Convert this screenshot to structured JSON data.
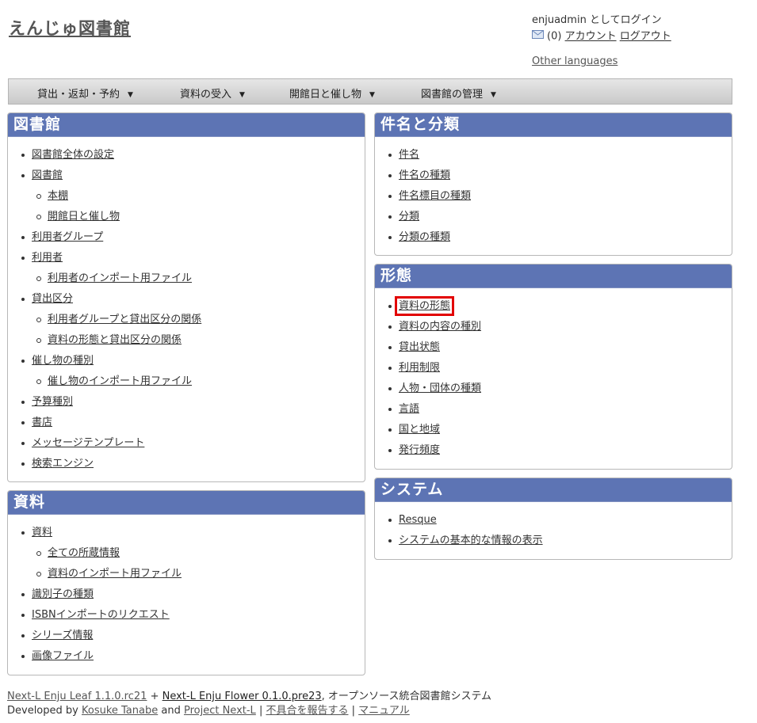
{
  "header": {
    "site_title": "えんじゅ図書館",
    "user_label": "enjuadmin としてログイン",
    "message_count": "(0)",
    "account_link": "アカウント",
    "logout_link": "ログアウト",
    "other_languages": "Other languages"
  },
  "nav": [
    {
      "label": "貸出・返却・予約"
    },
    {
      "label": "資料の受入"
    },
    {
      "label": "開館日と催し物"
    },
    {
      "label": "図書館の管理"
    }
  ],
  "panels": {
    "library": {
      "title": "図書館",
      "items": [
        {
          "label": "図書館全体の設定",
          "level": 1
        },
        {
          "label": "図書館",
          "level": 1
        },
        {
          "label": "本棚",
          "level": 2
        },
        {
          "label": "開館日と催し物",
          "level": 2
        },
        {
          "label": "利用者グループ",
          "level": 1
        },
        {
          "label": "利用者",
          "level": 1
        },
        {
          "label": "利用者のインポート用ファイル",
          "level": 2
        },
        {
          "label": "貸出区分",
          "level": 1
        },
        {
          "label": "利用者グループと貸出区分の関係",
          "level": 2
        },
        {
          "label": "資料の形態と貸出区分の関係",
          "level": 2
        },
        {
          "label": "催し物の種別",
          "level": 1
        },
        {
          "label": "催し物のインポート用ファイル",
          "level": 2
        },
        {
          "label": "予算種別",
          "level": 1
        },
        {
          "label": "書店",
          "level": 1
        },
        {
          "label": "メッセージテンプレート",
          "level": 1
        },
        {
          "label": "検索エンジン",
          "level": 1
        }
      ]
    },
    "resources": {
      "title": "資料",
      "items": [
        {
          "label": "資料",
          "level": 1
        },
        {
          "label": "全ての所蔵情報",
          "level": 2
        },
        {
          "label": "資料のインポート用ファイル",
          "level": 2
        },
        {
          "label": "識別子の種類",
          "level": 1
        },
        {
          "label": "ISBNインポートのリクエスト",
          "level": 1
        },
        {
          "label": "シリーズ情報",
          "level": 1
        },
        {
          "label": "画像ファイル",
          "level": 1
        }
      ]
    },
    "subjects": {
      "title": "件名と分類",
      "items": [
        {
          "label": "件名",
          "level": 1
        },
        {
          "label": "件名の種類",
          "level": 1
        },
        {
          "label": "件名標目の種類",
          "level": 1
        },
        {
          "label": "分類",
          "level": 1
        },
        {
          "label": "分類の種類",
          "level": 1
        }
      ]
    },
    "forms": {
      "title": "形態",
      "items": [
        {
          "label": "資料の形態",
          "level": 1,
          "highlighted": true
        },
        {
          "label": "資料の内容の種別",
          "level": 1
        },
        {
          "label": "貸出状態",
          "level": 1
        },
        {
          "label": "利用制限",
          "level": 1
        },
        {
          "label": "人物・団体の種類",
          "level": 1
        },
        {
          "label": "言語",
          "level": 1
        },
        {
          "label": "国と地域",
          "level": 1
        },
        {
          "label": "発行頻度",
          "level": 1
        }
      ]
    },
    "system": {
      "title": "システム",
      "items": [
        {
          "label": "Resque",
          "level": 1
        },
        {
          "label": "システムの基本的な情報の表示",
          "level": 1
        }
      ]
    }
  },
  "footer": {
    "leaf_link": "Next-L Enju Leaf 1.1.0.rc21",
    "plus": " + ",
    "flower_link": "Next-L Enju Flower 0.1.0.pre23",
    "tagline": ", オープンソース統合図書館システム",
    "developed_by": "Developed by ",
    "author_link": "Kosuke Tanabe",
    "and": " and ",
    "project_link": "Project Next-L",
    "sep": " | ",
    "report_link": "不具合を報告する",
    "manual_link": "マニュアル"
  },
  "colors": {
    "panel_header": "#5d74b4",
    "highlight": "#e20000"
  }
}
